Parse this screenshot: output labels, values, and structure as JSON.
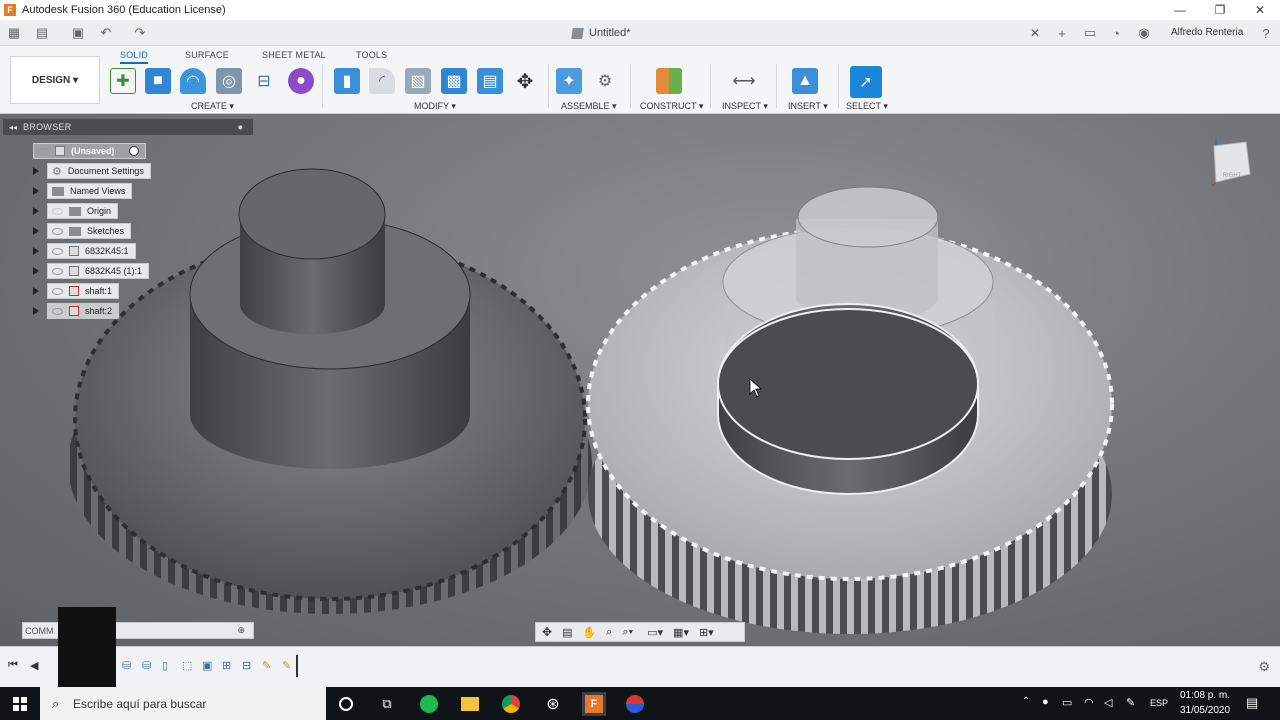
{
  "window": {
    "title": "Autodesk Fusion 360 (Education License)"
  },
  "document": {
    "title": "Untitled*",
    "user": "Alfredo Renteria"
  },
  "ribbon": {
    "tabs": [
      "SOLID",
      "SURFACE",
      "SHEET METAL",
      "TOOLS"
    ],
    "workspace": "DESIGN",
    "groups": [
      "CREATE",
      "MODIFY",
      "ASSEMBLE",
      "CONSTRUCT",
      "INSPECT",
      "INSERT",
      "SELECT"
    ]
  },
  "browser": {
    "title": "BROWSER",
    "items": [
      {
        "label": "(Unsaved)"
      },
      {
        "label": "Document Settings"
      },
      {
        "label": "Named Views"
      },
      {
        "label": "Origin"
      },
      {
        "label": "Sketches"
      },
      {
        "label": "6832K45:1"
      },
      {
        "label": "6832K45 (1):1"
      },
      {
        "label": "shaft:1"
      },
      {
        "label": "shaft:2"
      }
    ]
  },
  "viewcube": {
    "face": "RIGHT"
  },
  "comments": {
    "label": "COMM"
  },
  "taskbar": {
    "search_placeholder": "Escribe aquí para buscar",
    "lang": "ESP",
    "time": "01:08 p. m.",
    "date": "31/05/2020"
  },
  "colors": {
    "accent": "#0a6fc2",
    "fusion_orange": "#e8792c",
    "viewport": "#7a7d80"
  }
}
